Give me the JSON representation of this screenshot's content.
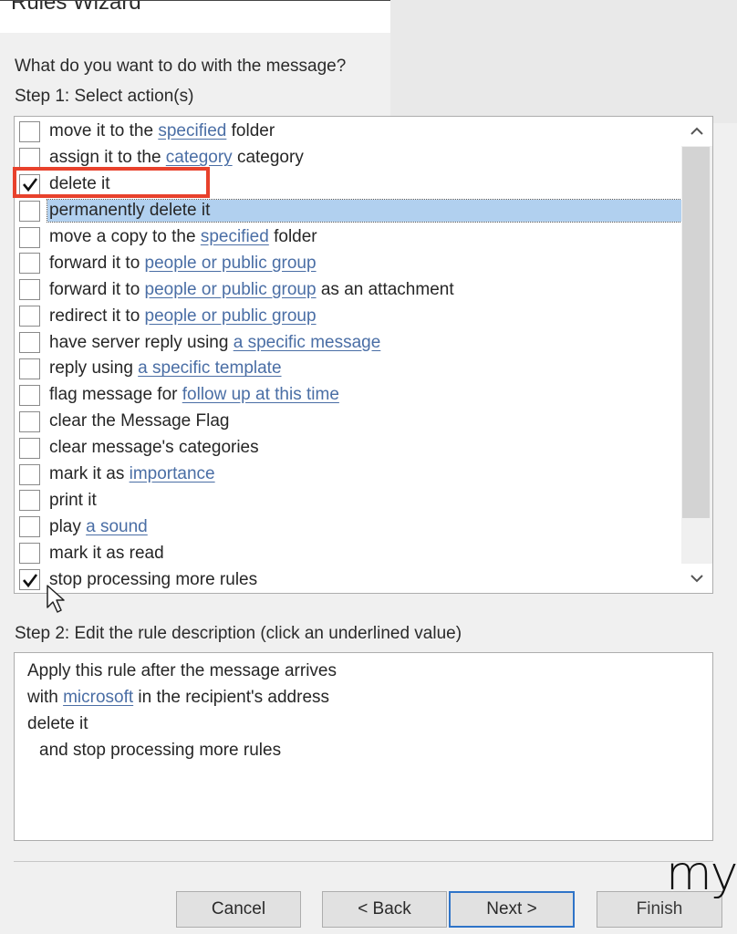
{
  "window": {
    "title": "Rules Wizard"
  },
  "prompt": {
    "question": "What do you want to do with the message?",
    "step1_label": "Step 1: Select action(s)"
  },
  "actions": [
    {
      "checked": false,
      "selected": false,
      "pre": "move it to the ",
      "link": "specified",
      "post": " folder"
    },
    {
      "checked": false,
      "selected": false,
      "pre": "assign it to the ",
      "link": "category",
      "post": " category"
    },
    {
      "checked": true,
      "selected": false,
      "pre": "delete it",
      "link": "",
      "post": ""
    },
    {
      "checked": false,
      "selected": true,
      "pre": "permanently delete it",
      "link": "",
      "post": ""
    },
    {
      "checked": false,
      "selected": false,
      "pre": "move a copy to the ",
      "link": "specified",
      "post": " folder"
    },
    {
      "checked": false,
      "selected": false,
      "pre": "forward it to ",
      "link": "people or public group",
      "post": ""
    },
    {
      "checked": false,
      "selected": false,
      "pre": "forward it to ",
      "link": "people or public group",
      "post": " as an attachment"
    },
    {
      "checked": false,
      "selected": false,
      "pre": "redirect it to ",
      "link": "people or public group",
      "post": ""
    },
    {
      "checked": false,
      "selected": false,
      "pre": "have server reply using ",
      "link": "a specific message",
      "post": ""
    },
    {
      "checked": false,
      "selected": false,
      "pre": "reply using ",
      "link": "a specific template",
      "post": ""
    },
    {
      "checked": false,
      "selected": false,
      "pre": "flag message for ",
      "link": "follow up at this time",
      "post": ""
    },
    {
      "checked": false,
      "selected": false,
      "pre": "clear the Message Flag",
      "link": "",
      "post": ""
    },
    {
      "checked": false,
      "selected": false,
      "pre": "clear message's categories",
      "link": "",
      "post": ""
    },
    {
      "checked": false,
      "selected": false,
      "pre": "mark it as ",
      "link": "importance",
      "post": ""
    },
    {
      "checked": false,
      "selected": false,
      "pre": "print it",
      "link": "",
      "post": ""
    },
    {
      "checked": false,
      "selected": false,
      "pre": "play ",
      "link": "a sound",
      "post": ""
    },
    {
      "checked": false,
      "selected": false,
      "pre": "mark it as read",
      "link": "",
      "post": ""
    },
    {
      "checked": true,
      "selected": false,
      "pre": "stop processing more rules",
      "link": "",
      "post": ""
    }
  ],
  "step2": {
    "label": "Step 2: Edit the rule description (click an underlined value)",
    "lines": [
      {
        "pre": "Apply this rule after the message arrives",
        "link": "",
        "post": "",
        "indent": false
      },
      {
        "pre": "with ",
        "link": "microsoft",
        "post": " in the recipient's address",
        "indent": false
      },
      {
        "pre": "delete it",
        "link": "",
        "post": "",
        "indent": false
      },
      {
        "pre": "and stop processing more rules",
        "link": "",
        "post": "",
        "indent": true
      }
    ]
  },
  "buttons": {
    "cancel": "Cancel",
    "back": "< Back",
    "next": "Next >",
    "finish": "Finish"
  },
  "watermark": "my",
  "colors": {
    "link": "#4a6ea5",
    "selection": "#b1d0ef",
    "highlight_annotation": "#e8412c",
    "default_button_border": "#2f74c8"
  }
}
